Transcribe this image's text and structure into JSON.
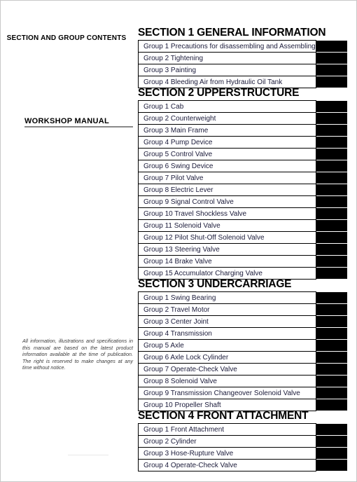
{
  "page": {
    "left_header": "SECTION AND GROUP CONTENTS",
    "manual_title": "WORKSHOP MANUAL",
    "disclaimer": "All information, illustrations and specifications in this manual are based on the latest product information available at the time of publication. The right is reserved to make changes at any time without notice.",
    "tab_color": "#000000",
    "text_color": "#1b1b3a",
    "rule_color": "#8a8a8a"
  },
  "sections": [
    {
      "heading": "SECTION 1 GENERAL INFORMATION",
      "groups": [
        "Group 1 Precautions for disassembling and Assembling",
        "Group 2 Tightening",
        "Group 3 Painting",
        "Group 4 Bleeding Air from Hydraulic Oil Tank"
      ]
    },
    {
      "heading": "SECTION 2 UPPERSTRUCTURE",
      "groups": [
        "Group 1 Cab",
        "Group 2 Counterweight",
        "Group 3 Main Frame",
        "Group 4 Pump Device",
        "Group 5 Control Valve",
        "Group 6 Swing Device",
        "Group 7 Pilot Valve",
        "Group 8 Electric Lever",
        "Group 9 Signal Control Valve",
        "Group 10 Travel Shockless Valve",
        "Group 11 Solenoid Valve",
        "Group 12 Pilot Shut-Off Solenoid Valve",
        "Group 13 Steering Valve",
        "Group 14 Brake Valve",
        "Group 15 Accumulator Charging Valve"
      ]
    },
    {
      "heading": "SECTION 3 UNDERCARRIAGE",
      "groups": [
        "Group 1 Swing Bearing",
        "Group 2 Travel Motor",
        "Group 3 Center Joint",
        "Group 4 Transmission",
        "Group 5 Axle",
        "Group 6 Axle Lock Cylinder",
        "Group 7 Operate-Check Valve",
        "Group 8 Solenoid Valve",
        "Group 9 Transmission Changeover Solenoid Valve",
        "Group 10 Propeller Shaft"
      ]
    },
    {
      "heading": "SECTION 4 FRONT ATTACHMENT",
      "groups": [
        "Group 1 Front Attachment",
        "Group 2 Cylinder",
        "Group 3 Hose-Rupture Valve",
        "Group 4 Operate-Check Valve"
      ]
    }
  ]
}
